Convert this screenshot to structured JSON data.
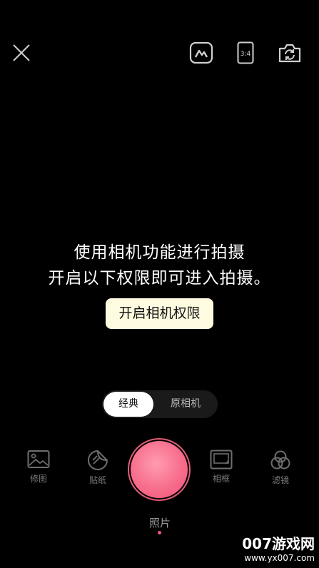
{
  "top_bar": {
    "close_icon": "close-icon",
    "gallery_icon": "gallery-icon",
    "ratio_label": "3:4",
    "flip_icon": "camera-flip-icon"
  },
  "permission": {
    "line1": "使用相机功能进行拍摄",
    "line2": "开启以下权限即可进入拍摄。",
    "button_label": "开启相机权限"
  },
  "mode_switch": {
    "options": [
      "经典",
      "原相机"
    ],
    "selected": "经典"
  },
  "tools": {
    "edit_label": "修图",
    "sticker_label": "贴纸",
    "frame_label": "相框",
    "filter_label": "滤镜"
  },
  "capture_tab": {
    "label": "照片"
  },
  "watermark": {
    "main": "007游戏网",
    "sub": "www.yx007.com"
  },
  "colors": {
    "accent": "#f0557a",
    "permission_button_bg": "#fffbe0"
  }
}
